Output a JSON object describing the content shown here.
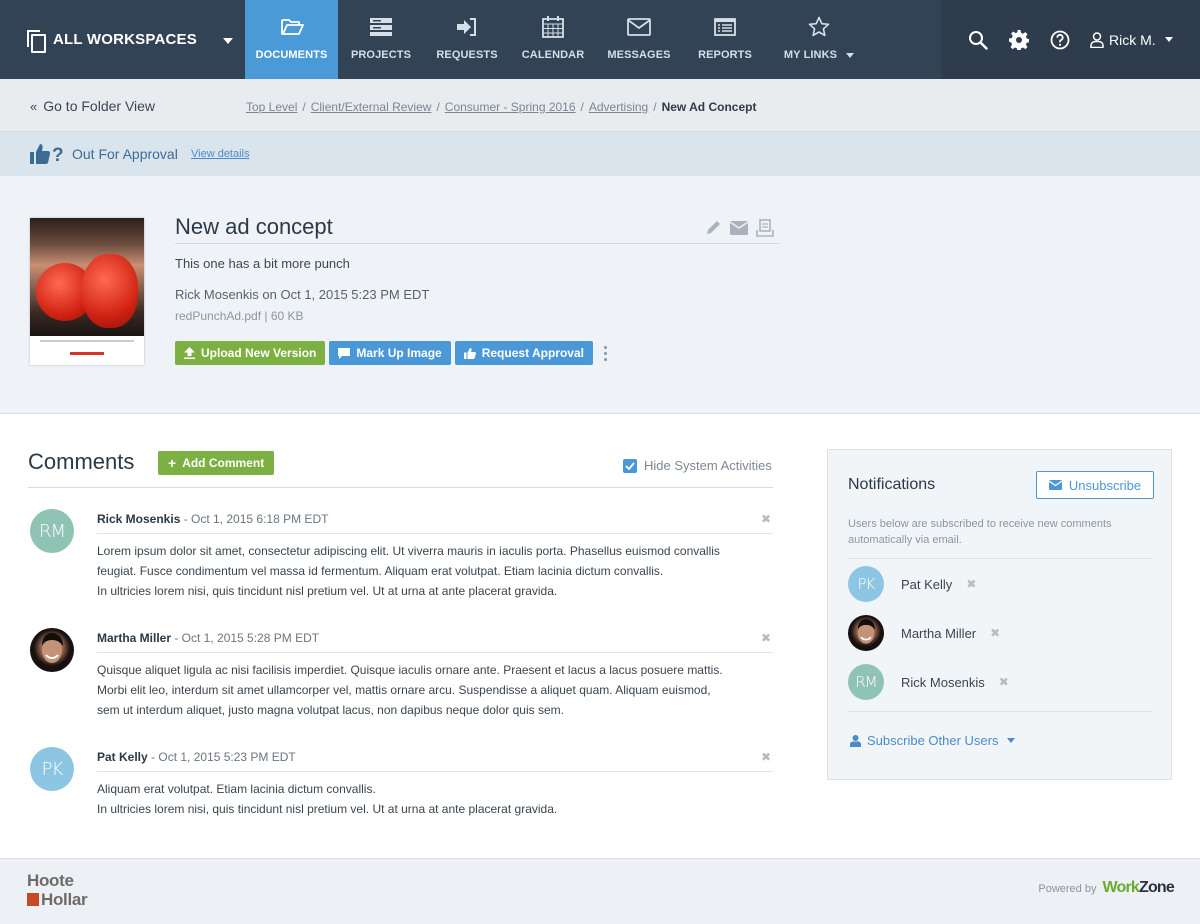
{
  "topnav": {
    "workspace_label": "ALL WORKSPACES",
    "items": [
      {
        "label": "DOCUMENTS",
        "icon": "folder-open-icon",
        "active": true
      },
      {
        "label": "PROJECTS",
        "icon": "server-stack-icon",
        "active": false
      },
      {
        "label": "REQUESTS",
        "icon": "sign-in-icon",
        "active": false
      },
      {
        "label": "CALENDAR",
        "icon": "calendar-icon",
        "active": false
      },
      {
        "label": "MESSAGES",
        "icon": "envelope-icon",
        "active": false
      },
      {
        "label": "REPORTS",
        "icon": "list-alt-icon",
        "active": false
      },
      {
        "label": "MY LINKS",
        "icon": "star-icon",
        "active": false
      }
    ],
    "tools": [
      "search-icon",
      "gear-icon",
      "help-icon"
    ],
    "user_name": "Rick M."
  },
  "crumbbar": {
    "folder_view_label": "Go to Folder View",
    "breadcrumb": [
      "Top Level",
      "Client/External Review",
      "Consumer - Spring 2016",
      "Advertising"
    ],
    "current": "New Ad Concept"
  },
  "status": {
    "label": "Out For Approval",
    "link": "View details"
  },
  "document": {
    "title": "New ad concept",
    "description": "This one has a bit more punch",
    "meta": "Rick Mosenkis on Oct 1, 2015 5:23 PM EDT",
    "file": "redPunchAd.pdf | 60 KB",
    "buttons": {
      "upload": "Upload New Version",
      "markup": "Mark Up Image",
      "request": "Request Approval"
    }
  },
  "comments": {
    "title": "Comments",
    "add_label": "Add Comment",
    "hide_system_label": "Hide System Activities",
    "hide_system_checked": true,
    "items": [
      {
        "initials": "RM",
        "author": "Rick Mosenkis",
        "date": " - Oct 1, 2015 6:18 PM EDT",
        "body": [
          "Lorem ipsum dolor sit amet, consectetur adipiscing elit. Ut viverra mauris in iaculis porta. Phasellus euismod convallis",
          "feugiat. Fusce condimentum vel massa id fermentum. Aliquam erat volutpat. Etiam lacinia dictum convallis.",
          "In ultricies lorem nisi, quis tincidunt nisl pretium vel. Ut at urna at ante placerat gravida."
        ]
      },
      {
        "initials": "",
        "author": "Martha Miller",
        "date": " - Oct 1, 2015 5:28 PM EDT",
        "body": [
          "Quisque aliquet ligula ac nisi facilisis imperdiet. Quisque iaculis ornare ante. Praesent et lacus a lacus posuere mattis.",
          "Morbi elit leo, interdum sit amet ullamcorper vel, mattis ornare arcu. Suspendisse a aliquet quam. Aliquam euismod,",
          "sem ut interdum aliquet, justo magna volutpat lacus, non dapibus neque dolor quis sem."
        ]
      },
      {
        "initials": "PK",
        "author": "Pat Kelly",
        "date": " - Oct 1, 2015 5:23 PM EDT",
        "body": [
          "Aliquam erat volutpat. Etiam lacinia dictum convallis.",
          "In ultricies lorem nisi, quis tincidunt nisl pretium vel. Ut at urna at ante placerat gravida."
        ]
      }
    ]
  },
  "notifications": {
    "title": "Notifications",
    "unsubscribe_label": "Unsubscribe",
    "description": "Users below are subscribed to receive new comments automatically via email.",
    "users": [
      {
        "initials": "PK",
        "name": "Pat Kelly"
      },
      {
        "initials": "",
        "name": "Martha Miller"
      },
      {
        "initials": "RM",
        "name": "Rick Mosenkis"
      }
    ],
    "subscribe_other_label": "Subscribe Other Users"
  },
  "footer": {
    "brand_line1": "Hoote",
    "brand_line2": "Hollar",
    "powered_by": "Powered by",
    "vendor_part1": "Work",
    "vendor_part2": "Zone"
  },
  "colors": {
    "nav_bg": "#334356",
    "nav_active": "#4a9ad7",
    "green": "#7db042",
    "blue": "#4a98d8"
  }
}
